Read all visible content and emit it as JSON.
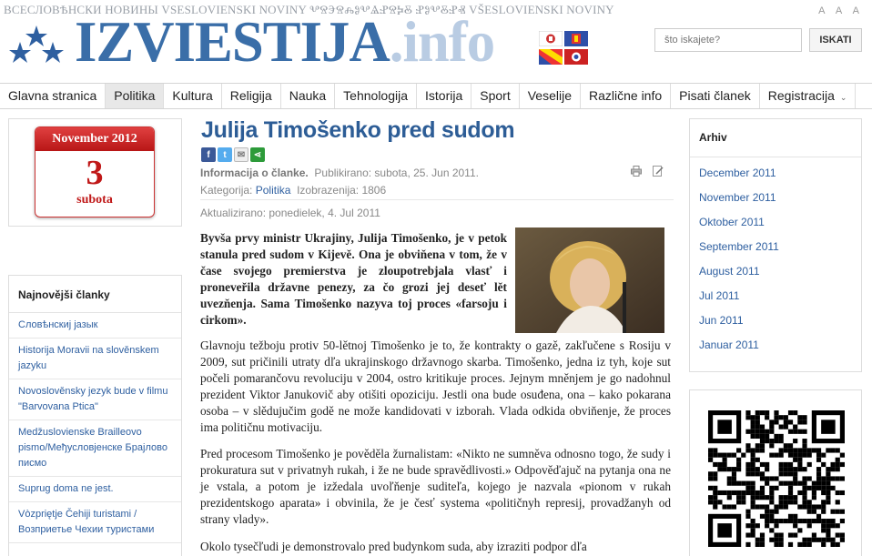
{
  "header": {
    "scripts_line": "ВСЕСЛОВѢНСКИ НОВИНЫ  VSESLOVIENSKI NOVINY  ⰂⰔⰅⰔⰎⰑⰂⰡⰐⰔⰍⰋ ⰐⰑⰂⰋⰐⰟ  VŠESLOVIENSKI NOVINY",
    "logo_main": "IZVIESTIJA",
    "logo_suffix": ".info",
    "font_sizer": [
      "A",
      "A",
      "A"
    ],
    "search_placeholder": "što iskajete?",
    "search_button": "ISKATI"
  },
  "nav": {
    "items": [
      "Glavna stranica",
      "Politika",
      "Kultura",
      "Religija",
      "Nauka",
      "Tehnologija",
      "Istorija",
      "Sport",
      "Veselije",
      "Različne info",
      "Pisati članek",
      "Registracija"
    ],
    "active_index": 1
  },
  "calendar": {
    "month": "November 2012",
    "day": "3",
    "weekday": "subota"
  },
  "latest": {
    "heading": "Najnovějši članky",
    "items": [
      "Словѣнскиј јазык",
      "Historija Moravii na slověnskem jazyku",
      "Novoslověnsky jezyk bude v filmu \"Barvovana Ptica\"",
      "Medžuslovienske Brailleovo pismo/Међусловјенске Брајлово писмо",
      "Suprug doma ne jest.",
      "Vòzpriętje Čehiji turistami / Возприетье Чехии туристами"
    ]
  },
  "article": {
    "title": "Julija Timošenko pred sudom",
    "info_label": "Informacija o članke.",
    "published": "Publikirano: subota, 25. Jun 2011.",
    "category_label": "Kategorija:",
    "category": "Politika",
    "views": "Izobrazenija: 1806",
    "updated": "Aktualizirano: ponedielek, 4. Jul 2011",
    "lead": "Byvša prvy ministr Ukrajiny, Julija Timošenko, je v petok stanula pred sudom v Kijevě. Ona je obviňena v tom, že v čase svojego premierstva je zloupotrebjala vlasť i proneveřila državne penezy, za čo grozi jej deseť lět uvezňenja. Sama Timošenko nazyva toj proces «farsoju i cirkom».",
    "paragraph1": "Glavnoju težboju protiv 50-lětnoj Timošenko je to, že kontrakty o gazě, zakľučene s Rosiju v 2009, sut pričinili utraty dľa ukrajinskogo državnogo skarba. Timošenko, jedna iz tyh, koje sut počeli pomarančovu revoluciju v 2004, ostro kritikuje proces. Jejnym mněnjem je go nadohnul prezident Viktor Janukovič aby otišiti opoziciju. Jestli ona bude osuđena, ona – kako pokarana osoba – v slědujučim godě ne može kandidovati v izborah. Vlada odkida obviňenje, že proces ima političnu motivaciju.",
    "paragraph2": "Pred procesom Timošenko je pověděla žurnalistam: «Nikto ne sumněva odnosno togo, že sudy i prokuratura sut v privatnyh rukah, i že ne bude spravědlivosti.» Odpověďajuč na pytanja ona ne je vstala, a potom je izžedala uvoľňenje suditeľa, kojego je nazvala «pionom v rukah prezidentskogo aparata» i obvinila, že je česť systema «političnyh represij, provadžanyh od strany vlady».",
    "paragraph3": "Okolo tysečľudi je demonstrovalo pred budynkom suda, aby izraziti podpor dľa"
  },
  "archive": {
    "heading": "Arhiv",
    "items": [
      "December 2011",
      "November 2011",
      "Oktober 2011",
      "September 2011",
      "August 2011",
      "Jul 2011",
      "Jun 2011",
      "Januar 2011"
    ]
  },
  "colors": {
    "accent": "#3a6ea8",
    "link": "#2e5fa0",
    "calendar_red": "#c01818"
  },
  "icons": [
    "facebook-icon",
    "twitter-icon",
    "email-icon",
    "share-icon",
    "print-icon",
    "edit-icon"
  ]
}
